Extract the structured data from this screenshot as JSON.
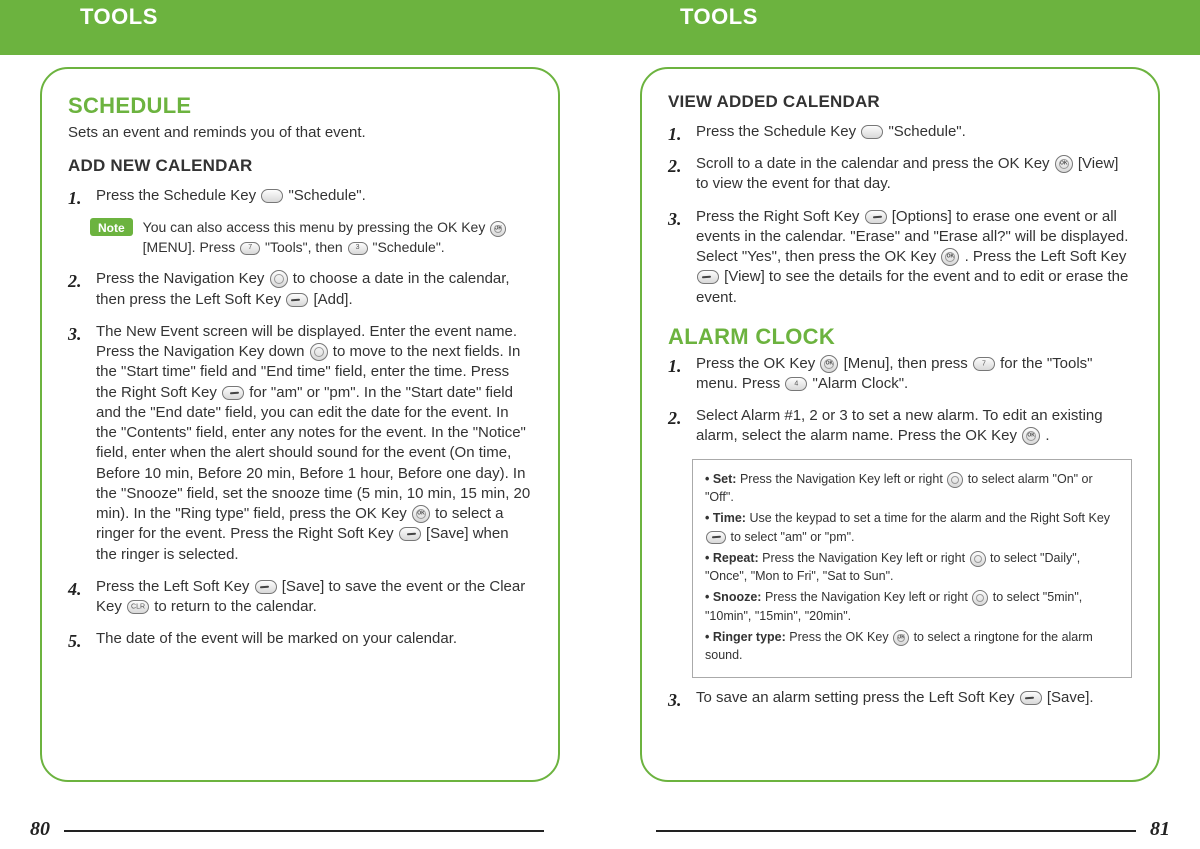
{
  "header": {
    "left": "TOOLS",
    "right": "TOOLS"
  },
  "page_left": {
    "num": "80",
    "schedule": {
      "title": "SCHEDULE",
      "desc": "Sets an event and reminds you of that event.",
      "add_title": "ADD NEW CALENDAR",
      "step1a": "Press the Schedule Key ",
      "step1b": " \"Schedule\".",
      "note_label": "Note",
      "note_text_a": "You can also access this menu by pressing the OK Key ",
      "note_text_b": " [MENU]. Press ",
      "note_text_c": " \"Tools\", then ",
      "note_text_d": " \"Schedule\".",
      "step2a": "Press the Navigation Key ",
      "step2b": " to choose a date in the calendar, then press the Left Soft Key ",
      "step2c": " [Add].",
      "step3a": "The New Event screen will be displayed.  Enter the event name.  Press the Navigation Key down ",
      "step3b": " to move to the next fields.  In the \"Start time\" field and \"End time\" field, enter the time.  Press the Right Soft Key ",
      "step3c": " for \"am\" or \"pm\".  In the \"Start date\" field and the \"End date\" field, you can edit the date for the event.  In the \"Contents\" field, enter any notes for the event.  In the \"Notice\" field, enter when the alert should sound for the event (On time, Before 10 min, Before 20 min, Before 1 hour, Before one day).  In the \"Snooze\" field, set the snooze time (5 min, 10 min, 15 min, 20 min).  In the \"Ring type\" field, press the OK Key ",
      "step3d": " to select a ringer for the event.  Press the Right Soft Key ",
      "step3e": " [Save] when the ringer is selected.",
      "step4a": "Press the Left Soft Key ",
      "step4b": " [Save] to save the event or the Clear Key ",
      "step4c": " to return to the calendar.",
      "step5": "The date of the event will be marked on your calendar."
    }
  },
  "page_right": {
    "num": "81",
    "view": {
      "title": "VIEW ADDED CALENDAR",
      "s1a": "Press the Schedule Key ",
      "s1b": " \"Schedule\".",
      "s2a": "Scroll to a date in the calendar and press the OK Key ",
      "s2b": " [View] to view the event for that day.",
      "s3a": "Press the Right Soft Key ",
      "s3b": " [Options] to erase one event or all events in the calendar.  \"Erase\" and \"Erase all?\" will be displayed.  Select \"Yes\", then press the OK Key ",
      "s3c": " . Press the Left Soft Key ",
      "s3d": " [View] to see the details for the event and to edit or erase the event."
    },
    "alarm": {
      "title": "ALARM CLOCK",
      "s1a": "Press the OK Key ",
      "s1b": " [Menu], then press ",
      "s1c": " for the \"Tools\" menu. Press ",
      "s1d": " \"Alarm Clock\".",
      "s2a": "Select Alarm #1, 2 or 3 to set a new alarm.  To edit an existing alarm, select the alarm name.  Press the OK Key ",
      "s2b": " .",
      "box": {
        "set_a": "• Set: ",
        "set_b": "Press the Navigation Key left or right ",
        "set_c": " to select alarm \"On\" or \"Off\".",
        "time_a": "• Time: ",
        "time_b": "Use the keypad to set a time for the alarm and the Right Soft Key ",
        "time_c": " to select \"am\" or \"pm\".",
        "repeat_a": "• Repeat: ",
        "repeat_b": "Press the Navigation Key left or right ",
        "repeat_c": " to select \"Daily\", \"Once\", \"Mon to Fri\", \"Sat to Sun\".",
        "snooze_a": "• Snooze: ",
        "snooze_b": "Press the Navigation Key left or right ",
        "snooze_c": " to select \"5min\", \"10min\", \"15min\", \"20min\".",
        "ringer_a": "• Ringer type: ",
        "ringer_b": "Press the OK Key ",
        "ringer_c": " to select a ringtone for the alarm sound."
      },
      "s3a": "To save an alarm setting press the Left Soft Key ",
      "s3b": " [Save]."
    }
  }
}
